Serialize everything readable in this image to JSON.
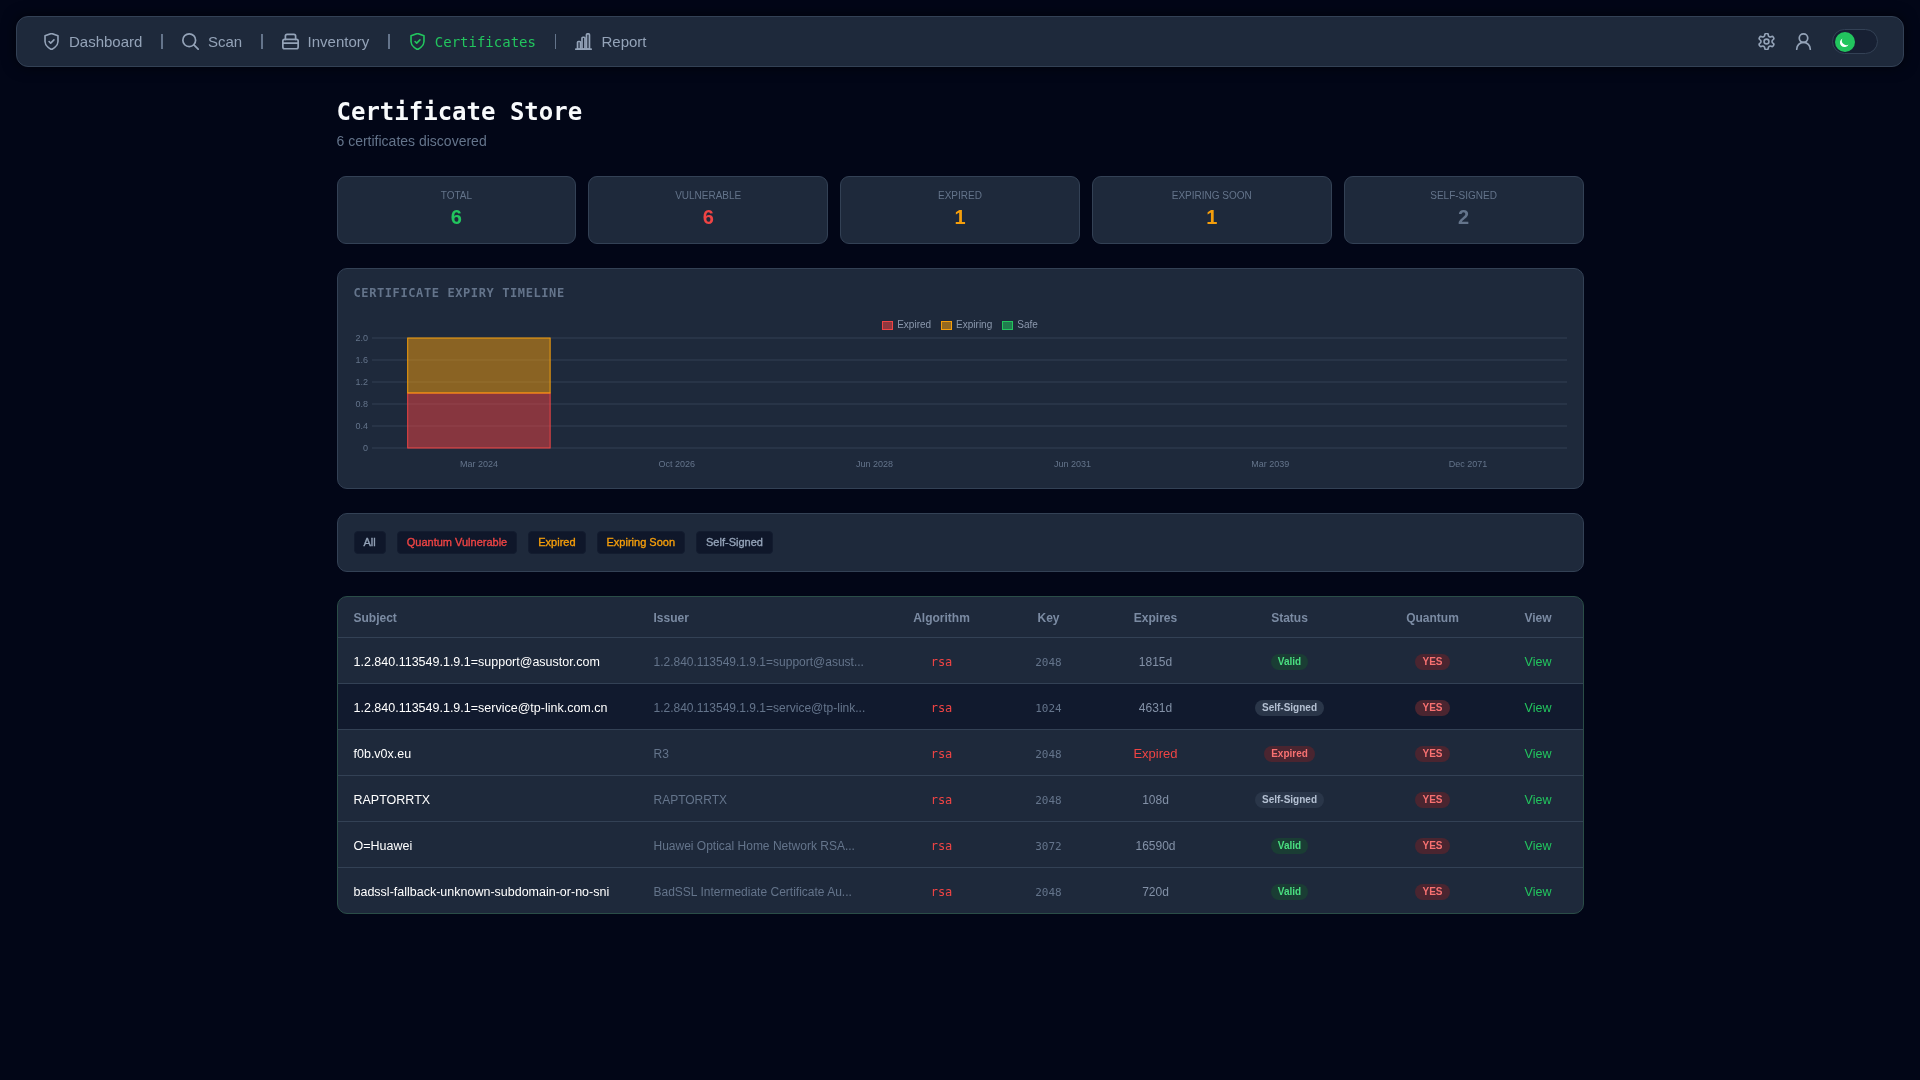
{
  "nav": {
    "items": [
      {
        "label": "Dashboard",
        "selected": false
      },
      {
        "label": "Scan",
        "selected": false
      },
      {
        "label": "Inventory",
        "selected": false
      },
      {
        "label": "Certificates",
        "selected": true
      },
      {
        "label": "Report",
        "selected": false
      }
    ],
    "theme_toggle": {
      "on": false
    }
  },
  "page": {
    "title": "Certificate Store",
    "subtitle": "6 certificates discovered"
  },
  "stats": [
    {
      "label": "TOTAL",
      "value": "6",
      "color": "#22c55e"
    },
    {
      "label": "VULNERABLE",
      "value": "6",
      "color": "#ef4444"
    },
    {
      "label": "EXPIRED",
      "value": "1",
      "color": "#f59e0b"
    },
    {
      "label": "EXPIRING SOON",
      "value": "1",
      "color": "#f59e0b"
    },
    {
      "label": "SELF-SIGNED",
      "value": "2",
      "color": "#64748b"
    }
  ],
  "timeline": {
    "chart_data": {
      "type": "bar",
      "title": "CERTIFICATE EXPIRY TIMELINE",
      "categories": [
        "Mar 2024",
        "Oct 2026",
        "Jun 2028",
        "Jun 2031",
        "Mar 2039",
        "Dec 2071"
      ],
      "series": [
        {
          "name": "Expired",
          "color": "#ef4444",
          "values": [
            1,
            0,
            0,
            0,
            0,
            0
          ]
        },
        {
          "name": "Expiring",
          "color": "#f59e0b",
          "values": [
            1,
            0,
            0,
            0,
            0,
            0
          ]
        },
        {
          "name": "Safe",
          "color": "#22c55e",
          "values": [
            0,
            0,
            0,
            0,
            0,
            0
          ]
        }
      ],
      "stacked": true,
      "grid": true,
      "ylim": [
        0,
        2
      ],
      "yticks": [
        0,
        0.4,
        0.8,
        1.2,
        1.6,
        {
          "value": 2,
          "label": "2.0"
        }
      ]
    }
  },
  "filters": [
    {
      "label": "All",
      "color": "#94a3b8"
    },
    {
      "label": "Quantum Vulnerable",
      "color": "#ef4444"
    },
    {
      "label": "Expired",
      "color": "#f59e0b"
    },
    {
      "label": "Expiring Soon",
      "color": "#f59e0b"
    },
    {
      "label": "Self-Signed",
      "color": "#94a3b8"
    }
  ],
  "table": {
    "columns": [
      "Subject",
      "Issuer",
      "Algorithm",
      "Key",
      "Expires",
      "Status",
      "Quantum",
      "View"
    ],
    "rows": [
      {
        "subject": "1.2.840.113549.1.9.1=support@asustor.com",
        "issuer": "1.2.840.113549.1.9.1=support@asust...",
        "algorithm": "rsa",
        "key": "2048",
        "expires": "1815d",
        "expired": false,
        "status": {
          "label": "Valid",
          "kind": "valid"
        },
        "quantum": "YES",
        "vulnerable": true,
        "action": "View",
        "highlighted": false
      },
      {
        "subject": "1.2.840.113549.1.9.1=service@tp-link.com.cn",
        "issuer": "1.2.840.113549.1.9.1=service@tp-link...",
        "algorithm": "rsa",
        "key": "1024",
        "expires": "4631d",
        "expired": false,
        "status": {
          "label": "Self-Signed",
          "kind": "self_signed"
        },
        "quantum": "YES",
        "vulnerable": true,
        "action": "View",
        "highlighted": true
      },
      {
        "subject": "f0b.v0x.eu",
        "issuer": "R3",
        "algorithm": "rsa",
        "key": "2048",
        "expires": "Expired",
        "expired": true,
        "status": {
          "label": "Expired",
          "kind": "expired"
        },
        "quantum": "YES",
        "vulnerable": true,
        "action": "View",
        "highlighted": false
      },
      {
        "subject": "RAPTORRTX",
        "issuer": "RAPTORRTX",
        "algorithm": "rsa",
        "key": "2048",
        "expires": "108d",
        "expired": false,
        "status": {
          "label": "Self-Signed",
          "kind": "self_signed"
        },
        "quantum": "YES",
        "vulnerable": true,
        "action": "View",
        "highlighted": false
      },
      {
        "subject": "O=Huawei",
        "issuer": "Huawei Optical Home Network RSA...",
        "algorithm": "rsa",
        "key": "3072",
        "expires": "16590d",
        "expired": false,
        "status": {
          "label": "Valid",
          "kind": "valid"
        },
        "quantum": "YES",
        "vulnerable": true,
        "action": "View",
        "highlighted": false
      },
      {
        "subject": "badssl-fallback-unknown-subdomain-or-no-sni",
        "issuer": "BadSSL Intermediate Certificate Au...",
        "algorithm": "rsa",
        "key": "2048",
        "expires": "720d",
        "expired": false,
        "status": {
          "label": "Valid",
          "kind": "valid"
        },
        "quantum": "YES",
        "vulnerable": true,
        "action": "View",
        "highlighted": false
      }
    ]
  }
}
